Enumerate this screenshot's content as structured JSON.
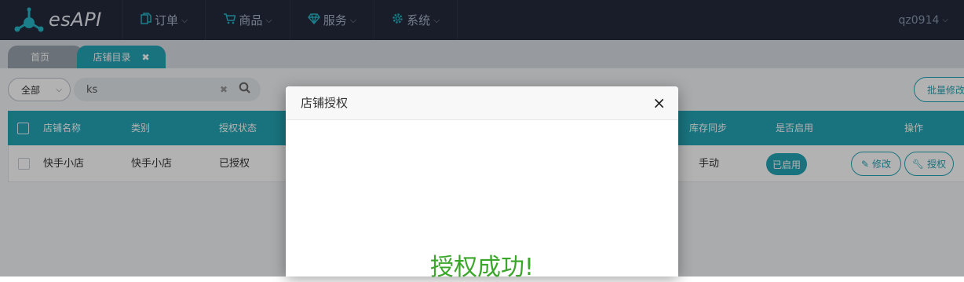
{
  "app": {
    "logo_text": "esAPI"
  },
  "nav": {
    "items": [
      {
        "label": "订单",
        "icon": "document-icon"
      },
      {
        "label": "商品",
        "icon": "cart-icon"
      },
      {
        "label": "服务",
        "icon": "diamond-icon"
      },
      {
        "label": "系统",
        "icon": "gear-icon"
      }
    ],
    "user": "qz0914"
  },
  "tabs": [
    {
      "label": "首页"
    },
    {
      "label": "店铺目录",
      "close": "✖"
    }
  ],
  "toolbar": {
    "filter_value": "全部",
    "search_value": "ks",
    "batch_label": "批量修改"
  },
  "table": {
    "headers": {
      "name": "店铺名称",
      "category": "类别",
      "auth_status": "授权状态",
      "stock_sync": "库存同步",
      "enabled": "是否启用",
      "actions": "操作"
    },
    "rows": [
      {
        "name": "快手小店",
        "category": "快手小店",
        "auth_status": "已授权",
        "stock_sync": "手动",
        "enabled": "已启用",
        "edit_label": "修改",
        "auth_label": "授权"
      }
    ]
  },
  "modal": {
    "title": "店铺授权",
    "close": "×",
    "message": "授权成功!"
  },
  "colors": {
    "accent": "#25a5b5",
    "topbar": "#232a3b",
    "success": "#3aa62a"
  }
}
